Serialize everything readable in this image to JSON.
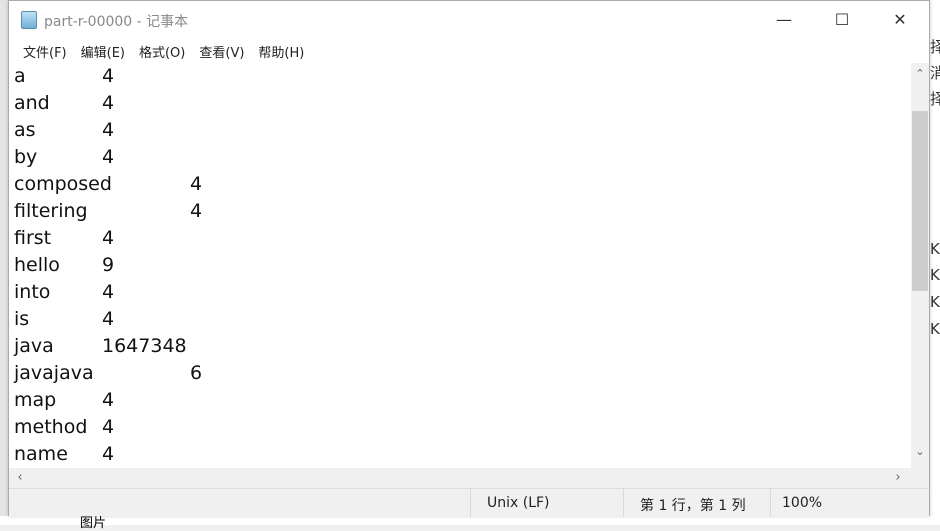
{
  "window": {
    "title": "part-r-00000 - 记事本",
    "minimize": "—",
    "maximize": "☐",
    "close": "✕"
  },
  "menu": [
    "文件(F)",
    "编辑(E)",
    "格式(O)",
    "查看(V)",
    "帮助(H)"
  ],
  "lines": [
    {
      "word": "a",
      "count": "4"
    },
    {
      "word": "and",
      "count": "4"
    },
    {
      "word": "as",
      "count": "4"
    },
    {
      "word": "by",
      "count": "4"
    },
    {
      "word": "composed",
      "count": "4"
    },
    {
      "word": "filtering",
      "count": "4"
    },
    {
      "word": "first",
      "count": "4"
    },
    {
      "word": "hello",
      "count": "9"
    },
    {
      "word": "into",
      "count": "4"
    },
    {
      "word": "is",
      "count": "4"
    },
    {
      "word": "java",
      "count": "1647348"
    },
    {
      "word": "javajava",
      "count": "6"
    },
    {
      "word": "map",
      "count": "4"
    },
    {
      "word": "method",
      "count": "4"
    },
    {
      "word": "name",
      "count": "4"
    }
  ],
  "status": {
    "line_ending": "Unix (LF)",
    "position": "第 1 行，第 1 列",
    "zoom": "100%"
  },
  "background": {
    "right_chars": [
      "择",
      "消",
      "择",
      "KE",
      "KE",
      "KE",
      "KE"
    ],
    "bottom_label": "图片"
  }
}
